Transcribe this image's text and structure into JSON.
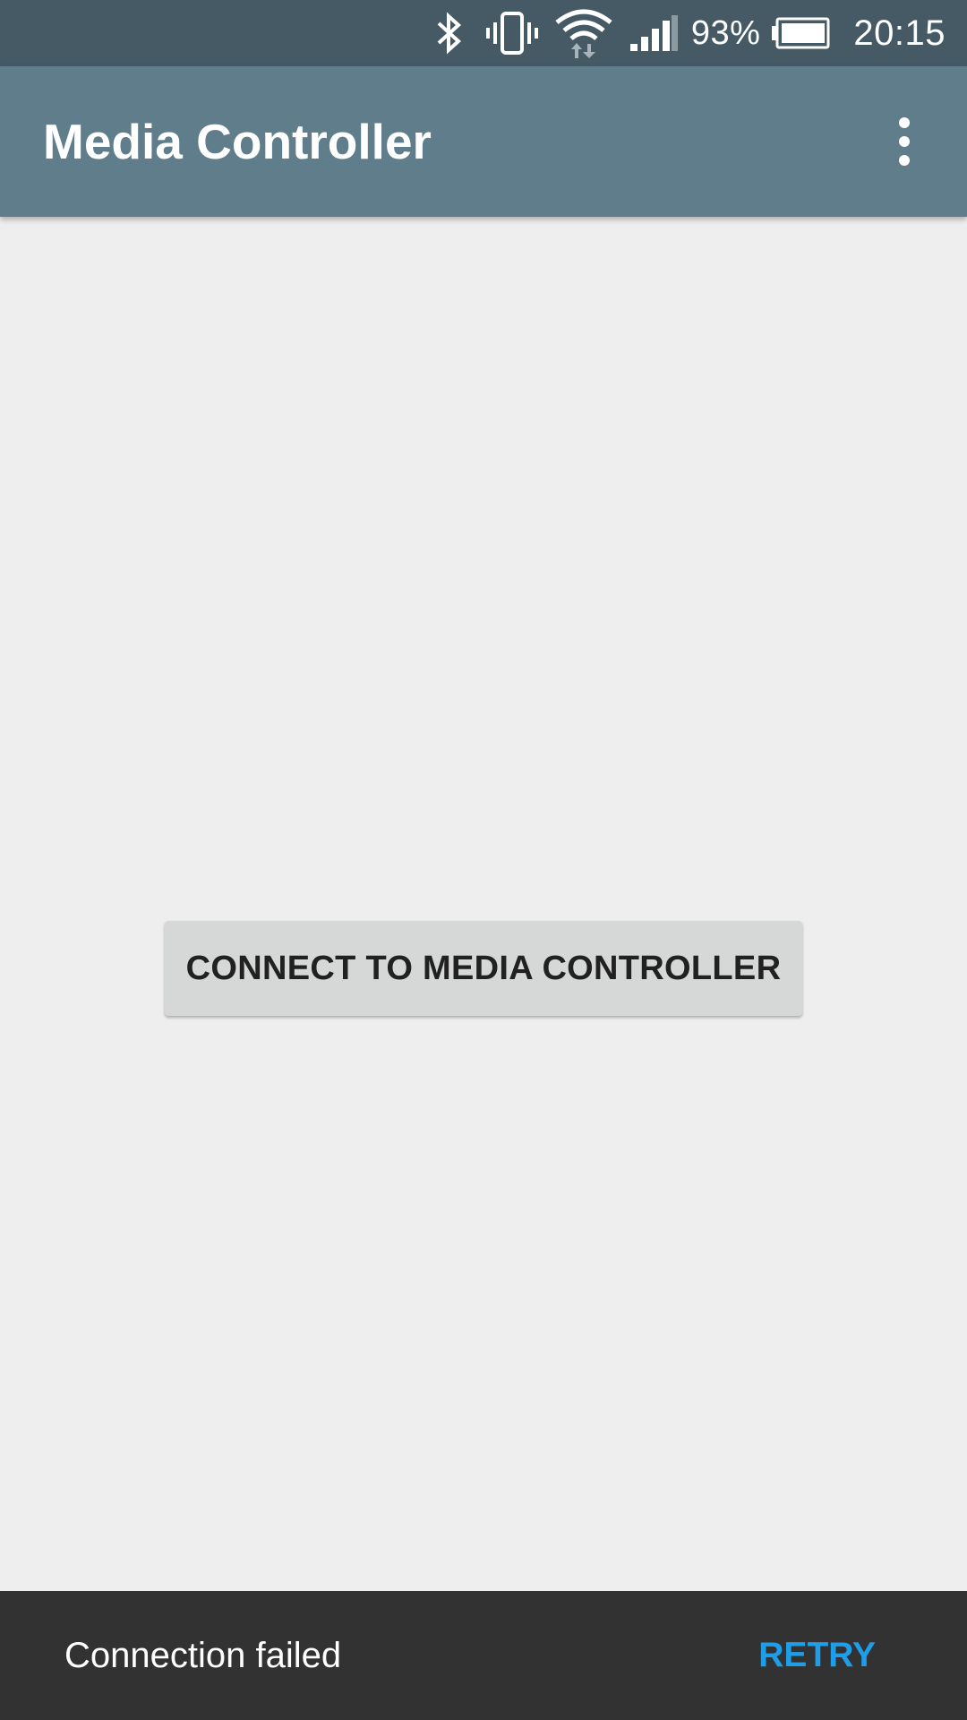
{
  "status_bar": {
    "battery_percent": "93%",
    "time": "20:15",
    "icons": [
      "bluetooth-icon",
      "vibrate-icon",
      "wifi-icon",
      "signal-icon",
      "battery-icon"
    ]
  },
  "app_bar": {
    "title": "Media Controller",
    "overflow_icon": "more-vert-icon"
  },
  "main": {
    "connect_button_label": "CONNECT TO MEDIA CONTROLLER"
  },
  "snackbar": {
    "message": "Connection failed",
    "action_label": "RETRY"
  },
  "colors": {
    "status_bar": "#455a64",
    "app_bar": "#607d8b",
    "background": "#eeeeee",
    "button": "#d6d7d7",
    "snackbar": "#323232",
    "snackbar_action": "#1e9ee8"
  }
}
